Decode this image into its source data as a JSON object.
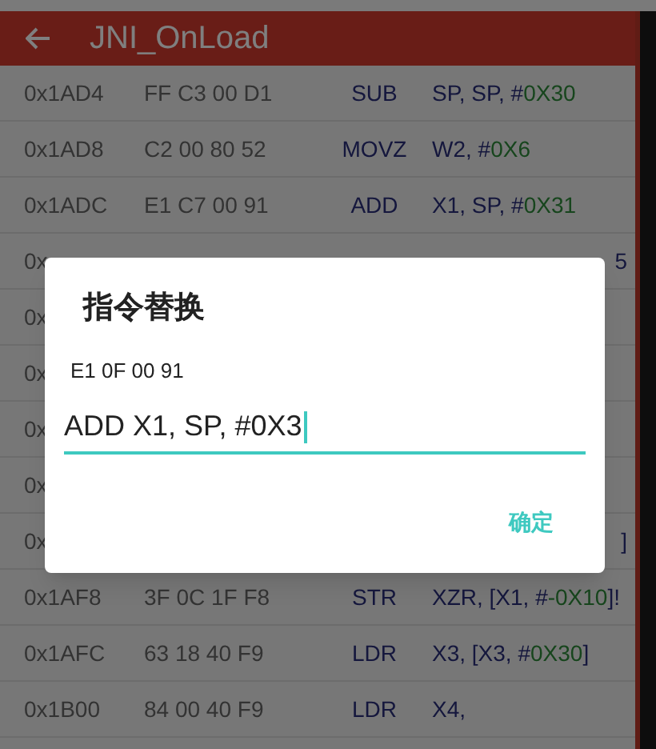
{
  "app_bar": {
    "title": "JNI_OnLoad"
  },
  "rows": [
    {
      "address": "0x1AD4",
      "bytes": "FF C3 00 D1",
      "op": "SUB",
      "operands": [
        {
          "kind": "reg",
          "text": "SP, SP, #"
        },
        {
          "kind": "imm",
          "text": "0X30"
        }
      ]
    },
    {
      "address": "0x1AD8",
      "bytes": "C2 00 80 52",
      "op": "MOVZ",
      "operands": [
        {
          "kind": "reg",
          "text": "W2, #"
        },
        {
          "kind": "imm",
          "text": "0X6"
        }
      ]
    },
    {
      "address": "0x1ADC",
      "bytes": "E1 C7 00 91",
      "op": "ADD",
      "operands": [
        {
          "kind": "reg",
          "text": "X1, SP, #"
        },
        {
          "kind": "imm",
          "text": "0X31"
        }
      ]
    },
    {
      "address": "0x",
      "operands": [
        {
          "kind": "reg",
          "text": "5"
        }
      ]
    },
    {
      "address": "0x"
    },
    {
      "address": "0x"
    },
    {
      "address": "0x"
    },
    {
      "address": "0x"
    },
    {
      "address": "0x",
      "operands": [
        {
          "kind": "reg",
          "text": "]"
        }
      ]
    },
    {
      "address": "0x1AF8",
      "bytes": "3F 0C 1F F8",
      "op": "STR",
      "operands": [
        {
          "kind": "reg",
          "text": "XZR, [X1, #"
        },
        {
          "kind": "imm",
          "text": "-0X10"
        },
        {
          "kind": "reg",
          "text": "]!"
        }
      ]
    },
    {
      "address": "0x1AFC",
      "bytes": "63 18 40 F9",
      "op": "LDR",
      "operands": [
        {
          "kind": "reg",
          "text": "X3, [X3, #"
        },
        {
          "kind": "imm",
          "text": "0X30"
        },
        {
          "kind": "reg",
          "text": "]"
        }
      ]
    },
    {
      "address": "0x1B00",
      "bytes": "84 00 40 F9",
      "op": "LDR",
      "operands": [
        {
          "kind": "reg",
          "text": "X4,"
        }
      ]
    }
  ],
  "dialog": {
    "title": "指令替换",
    "bytes": "E1 0F 00 91",
    "input": {
      "value": "ADD X1, SP, #0X3"
    },
    "button": "确定"
  }
}
